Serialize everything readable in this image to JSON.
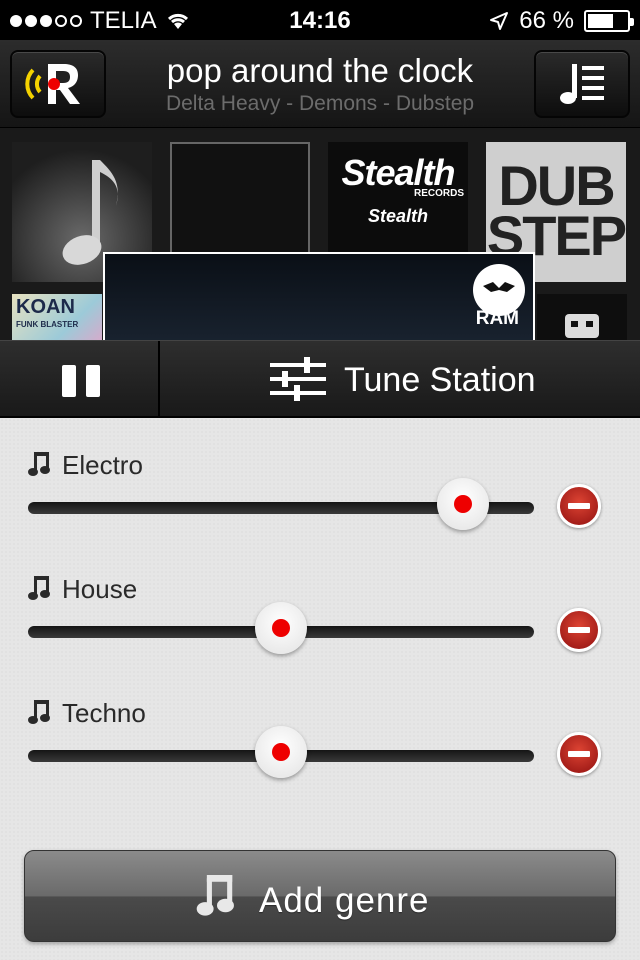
{
  "status_bar": {
    "carrier": "TELIA",
    "signal_bars": 3,
    "signal_total": 5,
    "time": "14:16",
    "battery_label": "66 %",
    "battery_level": 0.66
  },
  "nav": {
    "title": "pop around the clock",
    "subtitle": "Delta Heavy - Demons - Dubstep",
    "left_icon": "radio-logo-icon",
    "right_icon": "playlist-icon"
  },
  "albums": {
    "stealth": {
      "brand": "Stealth",
      "sub": "RECORDS"
    },
    "dubstep": {
      "line1": "DUB",
      "line2": "STEP"
    },
    "koan": {
      "title": "KOAN",
      "sub": "FUNK BLASTER"
    },
    "ram": {
      "label": "RAM"
    }
  },
  "controls": {
    "pause_icon": "pause-icon",
    "tune_icon": "sliders-icon",
    "tune_label": "Tune Station"
  },
  "genres": [
    {
      "name": "Electro",
      "level": 0.86
    },
    {
      "name": "House",
      "level": 0.5
    },
    {
      "name": "Techno",
      "level": 0.5
    }
  ],
  "add_button": {
    "label": "Add genre",
    "icon": "music-note-icon"
  },
  "colors": {
    "accent_red": "#e00000",
    "remove_red": "#b01818"
  }
}
